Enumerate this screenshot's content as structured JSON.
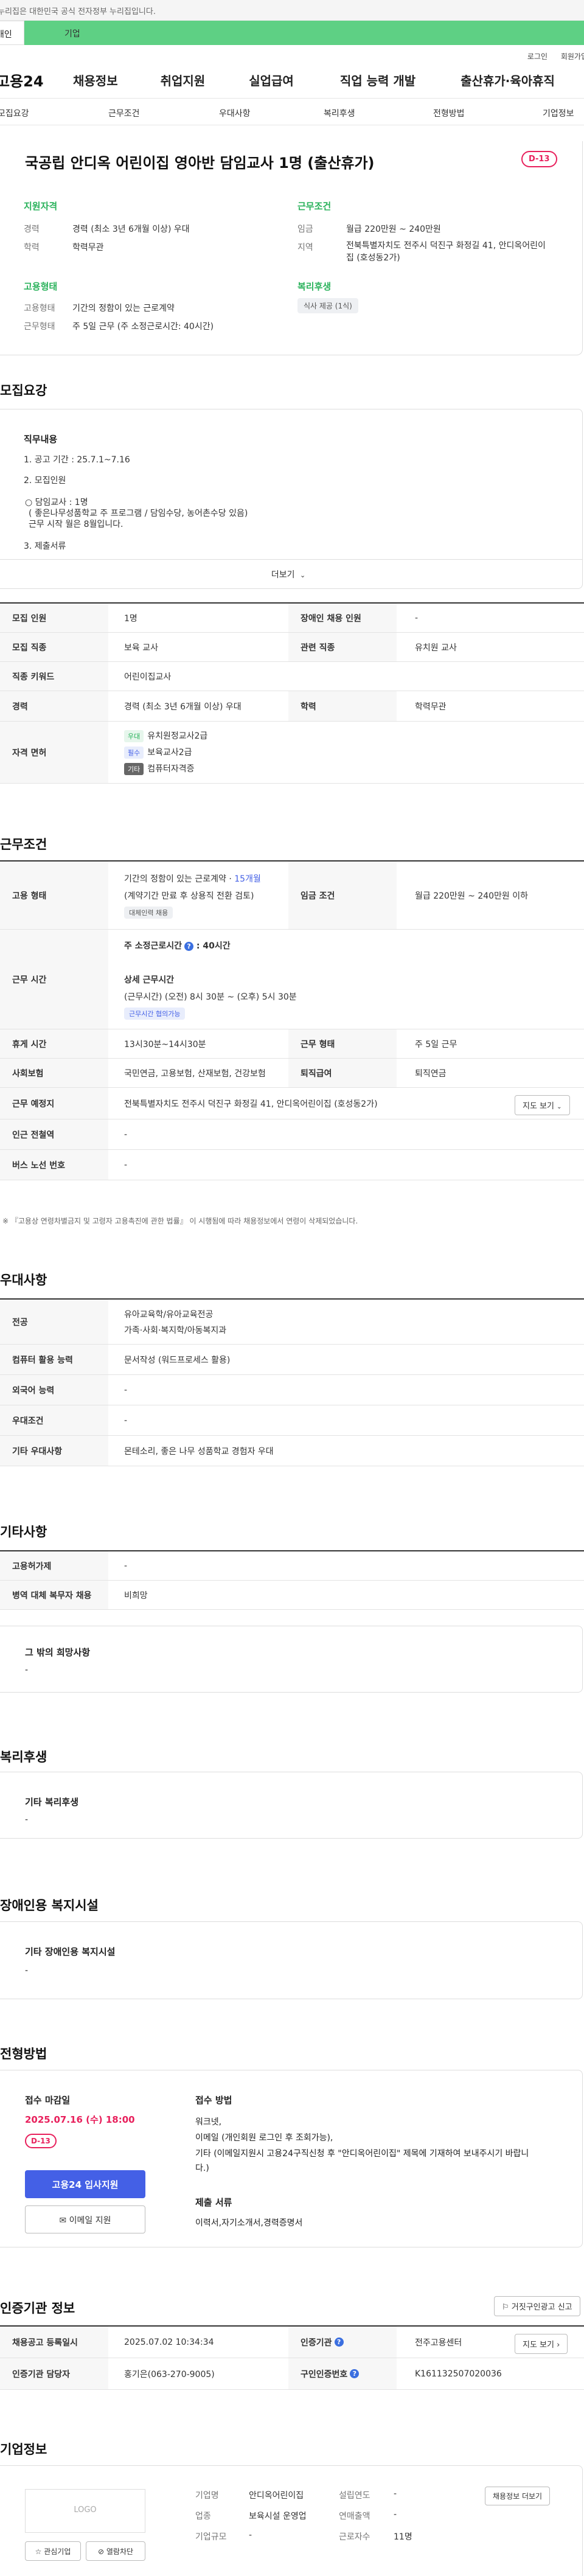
{
  "gov_banner": "이 누리집은 대한민국 공식 전자정부 누리집입니다.",
  "tabs": {
    "individual": "개인",
    "company": "기업"
  },
  "util": {
    "login": "로그인",
    "signup": "회원가입"
  },
  "gnb": {
    "logo": "고용24",
    "menu": [
      "채용정보",
      "취업지원",
      "실업급여",
      "직업 능력 개발",
      "출산휴가·육아휴직"
    ]
  },
  "anchors": [
    "모집요강",
    "근무조건",
    "우대사항",
    "복리후생",
    "전형방법",
    "기업정보"
  ],
  "headline": {
    "title": "국공립 안디옥 어린이집 영아반 담임교사 1명 (출산휴가)",
    "dday": "D-13",
    "qual_title": "지원자격",
    "qual": [
      {
        "k": "경력",
        "v": "경력 (최소 3년 6개월 이상) 우대"
      },
      {
        "k": "학력",
        "v": "학력무관"
      }
    ],
    "work_title": "근무조건",
    "work": [
      {
        "k": "임금",
        "v": "월급 220만원 ~ 240만원"
      },
      {
        "k": "지역",
        "v": "전북특별자치도 전주시 덕진구 화정길 41, 안디옥어린이집 (호성동2가)"
      }
    ],
    "emp_title": "고용형태",
    "emp": [
      {
        "k": "고용형태",
        "v": "기간의 정함이 있는 근로계약"
      },
      {
        "k": "근무형태",
        "v": "주 5일 근무 (주 소정근로시간: 40시간)"
      }
    ],
    "welfare_title": "복리후생",
    "welfare_chip": "식사 제공 (1식)"
  },
  "recruit": {
    "title": "모집요강",
    "box_title": "직무내용",
    "lines": [
      "1. 공고 기간 : 25.7.1~7.16",
      "2. 모집인원",
      "○ 담임교사 : 1명",
      "( 좋은나무성품학교 주 프로그램 / 담임수당, 농어촌수당 있음)",
      "근무 시작 월은  8월입니다.",
      "3. 제출서류"
    ],
    "more": "더보기",
    "table": [
      {
        "k": "모집 인원",
        "v": "1명",
        "k2": "장애인 채용 인원",
        "v2": "-"
      },
      {
        "k": "모집 직종",
        "v": "보육 교사",
        "k2": "관련 직종",
        "v2": "유치원 교사"
      },
      {
        "k": "직종 키워드",
        "v": "어린이집교사"
      },
      {
        "k": "경력",
        "v": "경력 (최소 3년 6개월 이상) 우대",
        "k2": "학력",
        "v2": "학력무관"
      }
    ],
    "license_label": "자격 면허",
    "licenses": [
      {
        "tag": "우대",
        "name": "유치원정교사2급"
      },
      {
        "tag": "필수",
        "name": "보육교사2급"
      },
      {
        "tag": "기타",
        "name": "컴퓨터자격증"
      }
    ]
  },
  "work_cond": {
    "title": "근무조건",
    "emp_label": "고용 형태",
    "emp_line1": "기간의 정함이 있는 근로계약 · ",
    "emp_months": "15개월",
    "emp_line2": "(계약기간 만료 후 상용직 전환 검토)",
    "emp_chip": "대체인력 채용",
    "wage_label": "임금 조건",
    "wage": "월급 220만원 ~ 240만원 이하",
    "hours_label": "근무 시간",
    "hours_weekly": "주 소정근로시간",
    "hours_weekly_val": "40시간",
    "hours_detail_title": "상세 근무시간",
    "hours_detail": "(근무시간) (오전) 8시 30분 ~ (오후) 5시 30분",
    "hours_chip": "근무시간 협의가능",
    "rows": [
      {
        "k": "휴게 시간",
        "v": "13시30분~14시30분",
        "k2": "근무 형태",
        "v2": "주 5일 근무"
      },
      {
        "k": "사회보험",
        "v": "국민연금, 고용보험, 산재보험, 건강보험",
        "k2": "퇴직급여",
        "v2": "퇴직연금"
      }
    ],
    "location_label": "근무 예정지",
    "location": "전북특별자치도 전주시 덕진구 화정길 41, 안디옥어린이집 (호성동2가)",
    "map_btn": "지도 보기",
    "station_label": "인근 전철역",
    "station": "-",
    "bus_label": "버스 노선 번호",
    "bus": "-",
    "note": "※ 『고용상 연령차별금지 및 고령자 고용촉진에 관한 법률』 이 시행됨에 따라 채용정보에서 연령이 삭제되었습니다."
  },
  "prefer": {
    "title": "우대사항",
    "rows": [
      {
        "k": "전공",
        "v": [
          "유아교육학/유아교육전공",
          "가족·사회·복지학/아동복지과"
        ]
      },
      {
        "k": "컴퓨터 활용 능력",
        "v": [
          "문서작성 (워드프로세스 활용)"
        ]
      },
      {
        "k": "외국어 능력",
        "v": [
          "-"
        ]
      },
      {
        "k": "우대조건",
        "v": [
          "-"
        ]
      },
      {
        "k": "기타 우대사항",
        "v": [
          "몬테소리, 좋은 나무 성품학교 경험자 우대"
        ]
      }
    ]
  },
  "etc": {
    "title": "기타사항",
    "rows": [
      {
        "k": "고용허가제",
        "v": "-"
      },
      {
        "k": "병역 대체 복무자 채용",
        "v": "비희망"
      }
    ],
    "other_title": "그 밖의 희망사항",
    "other_val": "-"
  },
  "welfare": {
    "title": "복리후생",
    "box_title": "기타 복리후생",
    "box_val": "-"
  },
  "disabled": {
    "title": "장애인용 복지시설",
    "box_title": "기타 장애인용 복지시설",
    "box_val": "-"
  },
  "screening": {
    "title": "전형방법",
    "deadline_label": "접수 마감일",
    "deadline": "2025.07.16 (수) 18:00",
    "dday": "D-13",
    "apply_btn": "고용24 입사지원",
    "email_btn": "이메일 지원",
    "method_title": "접수 방법",
    "method_lines": [
      "워크넷,",
      "이메일 (개인회원 로그인 후 조회가능),",
      "기타 (이메일지원시 고용24구직신청 후 \"안디옥어린이집\" 제목에 기재하여 보내주시기 바랍니",
      "다.)"
    ],
    "docs_title": "제출 서류",
    "docs": "이력서,자기소개서,경력증명서"
  },
  "cert": {
    "title": "인증기관 정보",
    "report_btn": "거짓구인광고 신고",
    "rows": [
      {
        "k": "채용공고 등록일시",
        "v": "2025.07.02 10:34:34",
        "k2": "인증기관",
        "v2": "전주고용센터",
        "btn": "지도 보기"
      },
      {
        "k": "인증기관 담당자",
        "v": "홍기은(063-270-9005)",
        "k2": "구인인증번호",
        "v2": "K161132507020036"
      }
    ]
  },
  "company": {
    "title": "기업정보",
    "logo": "LOGO",
    "fav_btn": "관심기업",
    "block_btn": "열람차단",
    "fields": [
      {
        "k": "기업명",
        "v": "안디옥어린이집",
        "k2": "설립연도",
        "v2": "-"
      },
      {
        "k": "업종",
        "v": "보육시설 운영업",
        "k2": "연매출액",
        "v2": "-"
      },
      {
        "k": "기업규모",
        "v": "-",
        "k2": "근로자수",
        "v2": "11명"
      }
    ],
    "jobs_btn": "채용정보 더보기"
  },
  "colors": {
    "green": "#2ab25b",
    "pink": "#e8205c",
    "blue": "#4460e6",
    "tab_green": "#5ed084"
  }
}
